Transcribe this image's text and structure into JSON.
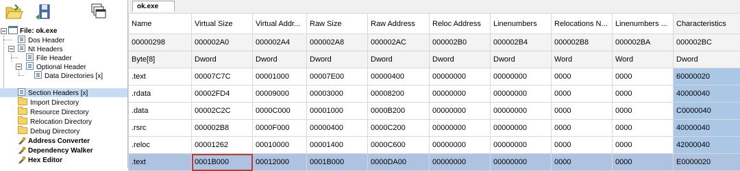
{
  "tabs": [
    {
      "label": "ok.exe"
    }
  ],
  "toolbar": {
    "icons": [
      "open-folder-icon",
      "save-icon",
      "windows-icon"
    ]
  },
  "tree": {
    "root": "File: ok.exe",
    "dos_header": "Dos Header",
    "nt_headers": "Nt Headers",
    "file_header": "File Header",
    "optional_header": "Optional Header",
    "data_directories": "Data Directories [x]",
    "section_headers": "Section Headers [x]",
    "import_directory": "Import Directory",
    "resource_directory": "Resource Directory",
    "relocation_directory": "Relocation Directory",
    "debug_directory": "Debug Directory",
    "address_converter": "Address Converter",
    "dependency_walker": "Dependency Walker",
    "hex_editor": "Hex Editor"
  },
  "table": {
    "columns": [
      "Name",
      "Virtual Size",
      "Virtual Addr...",
      "Raw Size",
      "Raw Address",
      "Reloc Address",
      "Linenumbers",
      "Relocations N...",
      "Linenumbers ...",
      "Characteristics"
    ],
    "offsets": [
      "00000298",
      "000002A0",
      "000002A4",
      "000002A8",
      "000002AC",
      "000002B0",
      "000002B4",
      "000002B8",
      "000002BA",
      "000002BC"
    ],
    "types": [
      "Byte[8]",
      "Dword",
      "Dword",
      "Dword",
      "Dword",
      "Dword",
      "Dword",
      "Word",
      "Word",
      "Dword"
    ],
    "rows": [
      [
        ".text",
        "00007C7C",
        "00001000",
        "00007E00",
        "00000400",
        "00000000",
        "00000000",
        "0000",
        "0000",
        "60000020"
      ],
      [
        ".rdata",
        "00002FD4",
        "00009000",
        "00003000",
        "00008200",
        "00000000",
        "00000000",
        "0000",
        "0000",
        "40000040"
      ],
      [
        ".data",
        "00002C2C",
        "0000C000",
        "00001000",
        "0000B200",
        "00000000",
        "00000000",
        "0000",
        "0000",
        "C0000040"
      ],
      [
        ".rsrc",
        "000002B8",
        "0000F000",
        "00000400",
        "0000C200",
        "00000000",
        "00000000",
        "0000",
        "0000",
        "40000040"
      ],
      [
        ".reloc",
        "00001262",
        "00010000",
        "00001400",
        "0000C600",
        "00000000",
        "00000000",
        "0000",
        "0000",
        "42000040"
      ],
      [
        ".text",
        "0001B000",
        "00012000",
        "0001B000",
        "0000DA00",
        "00000000",
        "00000000",
        "0000",
        "0000",
        "E0000020"
      ]
    ],
    "selected_row": 5,
    "focused_cell": "0001B000"
  }
}
